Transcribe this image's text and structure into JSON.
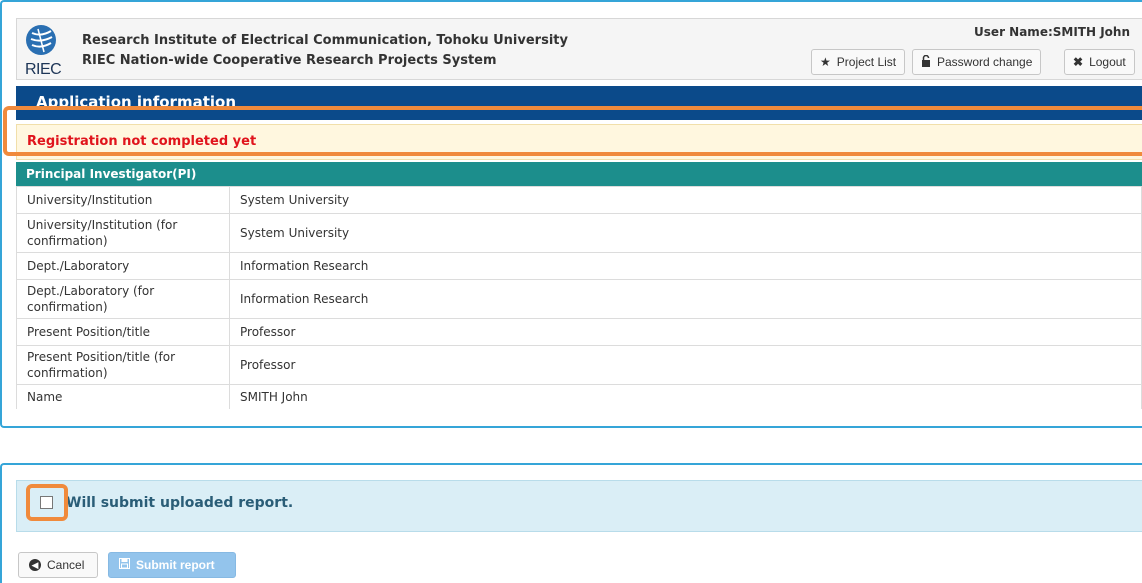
{
  "header": {
    "logo_text": "RIEC",
    "institution": "Research Institute of Electrical Communication, Tohoku University",
    "system_name": "RIEC Nation-wide Cooperative Research Projects System",
    "user_name": "User Name:SMITH John",
    "buttons": {
      "project_list": "Project List",
      "password_change": "Password change",
      "logout": "Logout"
    }
  },
  "section": {
    "title": "Application information"
  },
  "alert": {
    "message": "Registration not completed yet"
  },
  "pi": {
    "header": "Principal Investigator(PI)",
    "rows": [
      {
        "label": "University/Institution",
        "value": "System University"
      },
      {
        "label": "University/Institution (for confirmation)",
        "value": "System University"
      },
      {
        "label": "Dept./Laboratory",
        "value": "Information Research"
      },
      {
        "label": "Dept./Laboratory (for confirmation)",
        "value": "Information Research"
      },
      {
        "label": "Present Position/title",
        "value": "Professor"
      },
      {
        "label": "Present Position/title (for confirmation)",
        "value": "Professor"
      },
      {
        "label": "Name",
        "value": "SMITH John"
      }
    ]
  },
  "confirm": {
    "label": "Will submit uploaded report.",
    "checked": false
  },
  "actions": {
    "cancel": "Cancel",
    "submit": "Submit report"
  },
  "colors": {
    "section_bar": "#0b4a8a",
    "pi_header": "#1c8e8c",
    "alert_text": "#e0141c",
    "highlight": "#f08a3c",
    "frame": "#35a5d8",
    "submit_button": "#93c4ec"
  },
  "icons": {
    "project_list": "star-icon",
    "password_change": "lock-icon",
    "logout": "close-icon",
    "cancel": "circle-left-arrow-icon",
    "submit": "save-icon"
  }
}
